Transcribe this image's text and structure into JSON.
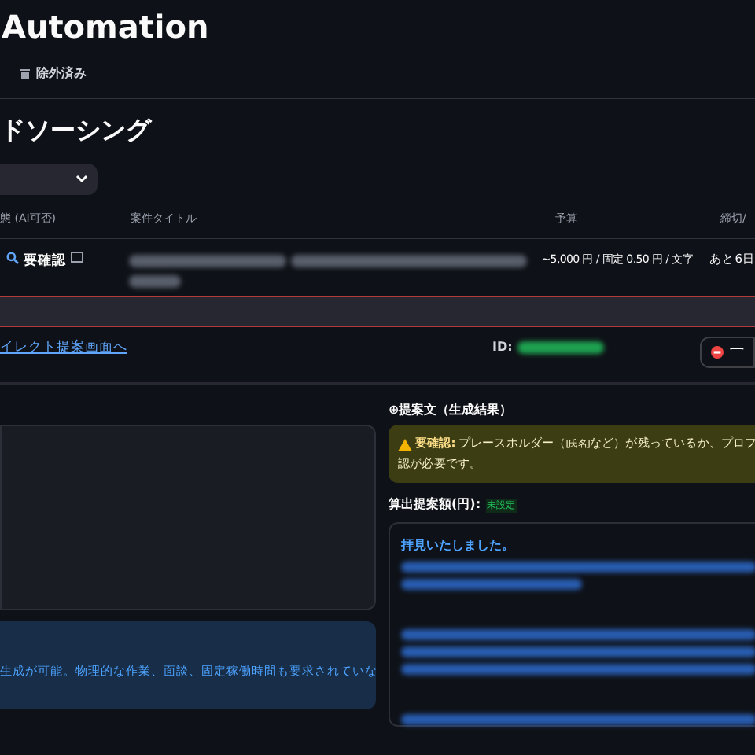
{
  "header": {
    "title": "Automation",
    "nav": [
      {
        "label": "除外済み"
      }
    ]
  },
  "section_title": "ドソーシング",
  "table": {
    "columns": [
      "態 (AI可否)",
      "案件タイトル",
      "予算",
      "締切/"
    ],
    "rows": [
      {
        "status": "要確認",
        "budget": "~5,000 円 / 固定 0.50 円 / 文字",
        "deadline": "あと6日",
        "expanded": true
      }
    ]
  },
  "detail": {
    "link": "イレクト提案画面へ",
    "id_label": "ID:",
    "exclude_button": "一"
  },
  "info_text": "生成が可能。物理的な作業、面談、固定稼働時間も要求されていな",
  "proposal": {
    "title": "⊕提案文（生成結果）",
    "warning_label": "要確認:",
    "warning_text": "プレースホルダー（",
    "warning_tag": "[氏名]",
    "warning_rest": "など）が残っているか、プロフ",
    "warning_line2": "認が必要です。",
    "amount_label": "算出提案額(円):",
    "amount_badge": "未設定",
    "greeting": "拝見いたしました。"
  }
}
